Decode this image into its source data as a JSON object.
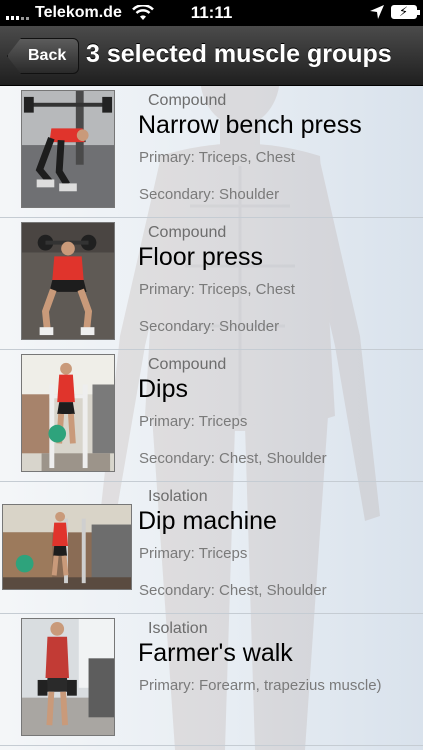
{
  "status_bar": {
    "carrier": "Telekom.de",
    "time": "11:11"
  },
  "nav": {
    "back_label": "Back",
    "title": "3 selected muscle groups"
  },
  "exercises": [
    {
      "category": "Compound",
      "name": "Narrow bench press",
      "primary": "Primary: Triceps, Chest",
      "secondary": "Secondary: Shoulder"
    },
    {
      "category": "Compound",
      "name": "Floor press",
      "primary": "Primary: Triceps, Chest",
      "secondary": "Secondary: Shoulder"
    },
    {
      "category": "Compound",
      "name": "Dips",
      "primary": "Primary: Triceps",
      "secondary": "Secondary: Chest, Shoulder"
    },
    {
      "category": "Isolation",
      "name": "Dip machine",
      "primary": "Primary: Triceps",
      "secondary": "Secondary: Chest, Shoulder"
    },
    {
      "category": "Isolation",
      "name": "Farmer's walk",
      "primary": "Primary: Forearm, trapezius muscle)",
      "secondary": ""
    }
  ]
}
